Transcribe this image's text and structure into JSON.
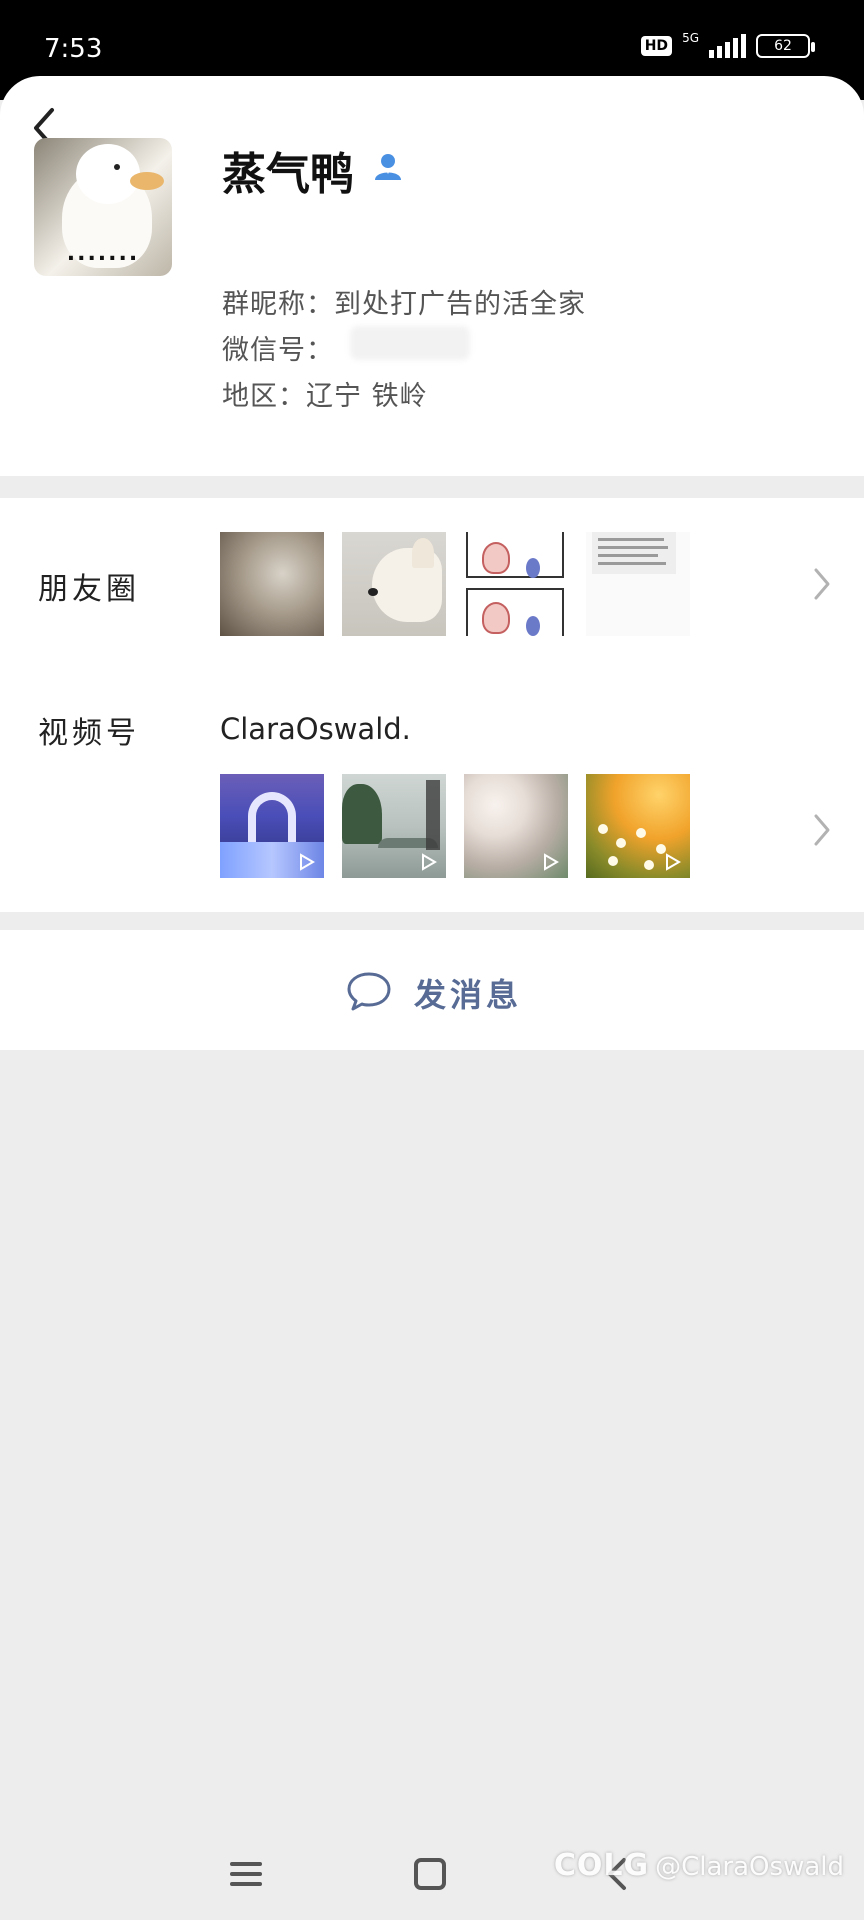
{
  "status_bar": {
    "time": "7:53",
    "hd": "HD",
    "network": "5G",
    "battery": "62"
  },
  "profile": {
    "name": "蒸气鸭",
    "avatar_caption": ".......",
    "group_nickname": "群昵称：到处打广告的活全家",
    "wechat_id_label": "微信号：",
    "region": "地区：辽宁 铁岭"
  },
  "moments": {
    "label": "朋友圈"
  },
  "channels": {
    "label": "视频号",
    "account": "ClaraOswald."
  },
  "message": {
    "label": "发消息"
  },
  "watermark": {
    "logo": "COLG",
    "handle": "@ClaraOswald"
  },
  "colors": {
    "accent": "#576b95",
    "badge_blue": "#4a90e2",
    "page_bg": "#ededed"
  }
}
